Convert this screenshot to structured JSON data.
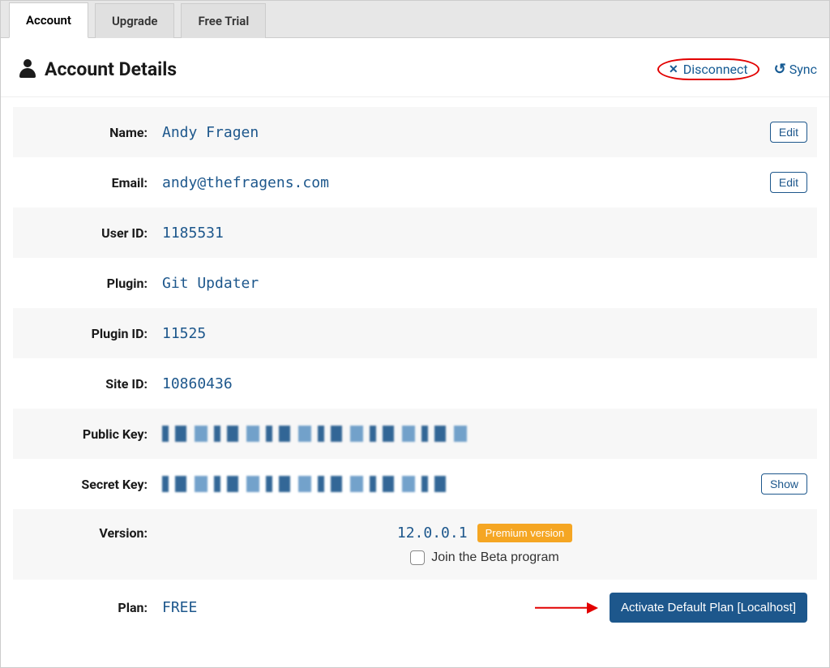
{
  "tabs": {
    "account": "Account",
    "upgrade": "Upgrade",
    "free_trial": "Free Trial"
  },
  "header": {
    "title": "Account Details",
    "disconnect": "Disconnect",
    "sync": "Sync"
  },
  "labels": {
    "name": "Name:",
    "email": "Email:",
    "user_id": "User ID:",
    "plugin": "Plugin:",
    "plugin_id": "Plugin ID:",
    "site_id": "Site ID:",
    "public_key": "Public Key:",
    "secret_key": "Secret Key:",
    "version": "Version:",
    "plan": "Plan:"
  },
  "values": {
    "name": "Andy Fragen",
    "email": "andy@thefragens.com",
    "user_id": "1185531",
    "plugin": "Git Updater",
    "plugin_id": "11525",
    "site_id": "10860436",
    "version": "12.0.0.1",
    "plan": "FREE"
  },
  "buttons": {
    "edit": "Edit",
    "show": "Show",
    "activate": "Activate Default Plan [Localhost]"
  },
  "badges": {
    "premium": "Premium version"
  },
  "beta": {
    "label": "Join the Beta program"
  }
}
